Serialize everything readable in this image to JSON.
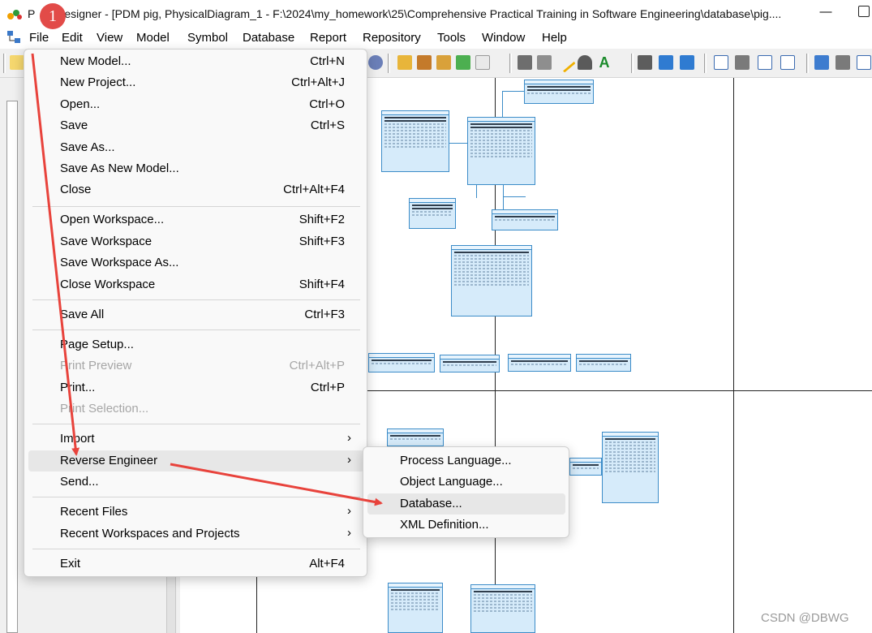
{
  "window": {
    "title": "PowerDesigner - [PDM pig, PhysicalDiagram_1 - F:\\2024\\my_homework\\25\\Comprehensive Practical Training in Software Engineering\\database\\pig....",
    "title_visible": "esigner - [PDM pig, PhysicalDiagram_1 - F:\\2024\\my_homework\\25\\Comprehensive Practical Training in Software Engineering\\database\\pig....",
    "title_prefix": "P",
    "minimize": "—"
  },
  "menubar": {
    "items": [
      "File",
      "Edit",
      "View",
      "Model",
      "Symbol",
      "Database",
      "Report",
      "Repository",
      "Tools",
      "Window",
      "Help"
    ]
  },
  "file_menu": {
    "items": [
      {
        "label": "New Model...",
        "shortcut": "Ctrl+N"
      },
      {
        "label": "New Project...",
        "shortcut": "Ctrl+Alt+J"
      },
      {
        "label": "Open...",
        "shortcut": "Ctrl+O"
      },
      {
        "label": "Save",
        "shortcut": "Ctrl+S"
      },
      {
        "label": "Save As...",
        "shortcut": ""
      },
      {
        "label": "Save As New Model...",
        "shortcut": ""
      },
      {
        "label": "Close",
        "shortcut": "Ctrl+Alt+F4"
      },
      {
        "label": "Open Workspace...",
        "shortcut": "Shift+F2"
      },
      {
        "label": "Save Workspace",
        "shortcut": "Shift+F3"
      },
      {
        "label": "Save Workspace As...",
        "shortcut": ""
      },
      {
        "label": "Close Workspace",
        "shortcut": "Shift+F4"
      },
      {
        "label": "Save All",
        "shortcut": "Ctrl+F3"
      },
      {
        "label": "Page Setup...",
        "shortcut": ""
      },
      {
        "label": "Print Preview",
        "shortcut": "Ctrl+Alt+P"
      },
      {
        "label": "Print...",
        "shortcut": "Ctrl+P"
      },
      {
        "label": "Print Selection...",
        "shortcut": ""
      },
      {
        "label": "Import",
        "shortcut": ""
      },
      {
        "label": "Reverse Engineer",
        "shortcut": ""
      },
      {
        "label": "Send...",
        "shortcut": ""
      },
      {
        "label": "Recent Files",
        "shortcut": ""
      },
      {
        "label": "Recent Workspaces and Projects",
        "shortcut": ""
      },
      {
        "label": "Exit",
        "shortcut": "Alt+F4"
      }
    ]
  },
  "reverse_engineer_submenu": {
    "items": [
      "Process Language...",
      "Object Language...",
      "Database...",
      "XML Definition..."
    ]
  },
  "annotation": {
    "badge": "1"
  },
  "watermark": "CSDN @DBWG",
  "colors": {
    "arrow": "#e8433c",
    "table_fill": "#d6ebfa",
    "table_border": "#3c8cc8",
    "badge": "#e24b48"
  }
}
